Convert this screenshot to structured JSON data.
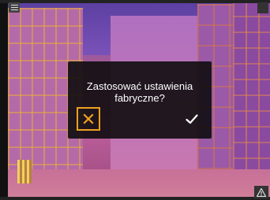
{
  "dialog": {
    "message": "Zastosować ustawienia fabryczne?",
    "cancel_icon": "close-icon",
    "confirm_icon": "check-icon"
  },
  "toolbar": {
    "menu_icon": "menu-icon",
    "warning_icon": "warning-icon"
  },
  "colors": {
    "cancel_accent": "#f0a020",
    "dialog_bg": "#0a0a0a",
    "text": "#ffffff"
  }
}
